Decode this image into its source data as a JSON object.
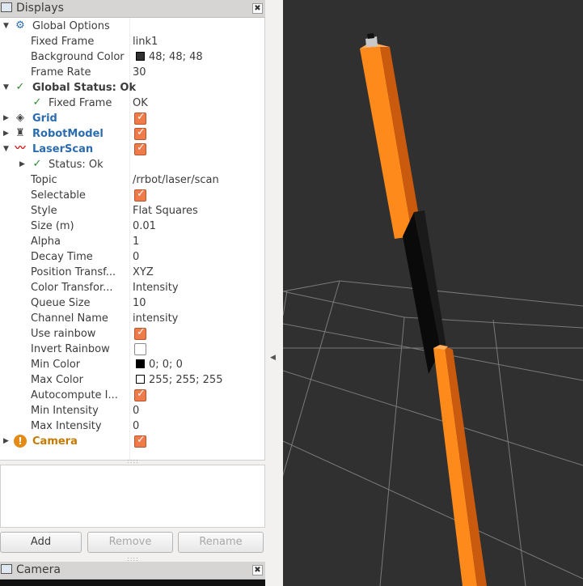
{
  "displays_panel": {
    "title": "Displays",
    "close_glyph": "✖",
    "rows": [
      {
        "name": "Global Options",
        "value": "",
        "kind": "group"
      },
      {
        "name": "Fixed Frame",
        "value": "link1"
      },
      {
        "name": "Background Color",
        "value": "48; 48; 48",
        "swatch": "#303030"
      },
      {
        "name": "Frame Rate",
        "value": "30"
      },
      {
        "name": "Global Status: Ok",
        "value": "",
        "kind": "status"
      },
      {
        "name": "Fixed Frame",
        "value": "OK"
      },
      {
        "name": "Grid",
        "value": ""
      },
      {
        "name": "RobotModel",
        "value": ""
      },
      {
        "name": "LaserScan",
        "value": ""
      },
      {
        "name": "Status: Ok",
        "value": ""
      },
      {
        "name": "Topic",
        "value": "/rrbot/laser/scan"
      },
      {
        "name": "Selectable",
        "value": ""
      },
      {
        "name": "Style",
        "value": "Flat Squares"
      },
      {
        "name": "Size (m)",
        "value": "0.01"
      },
      {
        "name": "Alpha",
        "value": "1"
      },
      {
        "name": "Decay Time",
        "value": "0"
      },
      {
        "name": "Position Transf...",
        "value": "XYZ"
      },
      {
        "name": "Color Transfor...",
        "value": "Intensity"
      },
      {
        "name": "Queue Size",
        "value": "10"
      },
      {
        "name": "Channel Name",
        "value": "intensity"
      },
      {
        "name": "Use rainbow",
        "value": ""
      },
      {
        "name": "Invert Rainbow",
        "value": ""
      },
      {
        "name": "Min Color",
        "value": "0; 0; 0",
        "swatch": "#000000"
      },
      {
        "name": "Max Color",
        "value": "255; 255; 255",
        "swatch": "#ffffff"
      },
      {
        "name": "Autocompute I...",
        "value": ""
      },
      {
        "name": "Min Intensity",
        "value": "0"
      },
      {
        "name": "Max Intensity",
        "value": "0"
      },
      {
        "name": "Camera",
        "value": ""
      }
    ],
    "checkboxes": {
      "grid": true,
      "robotmodel": true,
      "laserscan": true,
      "selectable": true,
      "use_rainbow": true,
      "invert_rainbow": false,
      "autocompute": true,
      "camera": true
    }
  },
  "buttons": {
    "add": "Add",
    "remove": "Remove",
    "rename": "Rename"
  },
  "camera_panel": {
    "title": "Camera",
    "close_glyph": "✖"
  },
  "colors": {
    "background": "#303030",
    "link_orange": "#ff8a1c",
    "link_orange_dark": "#c95a0e",
    "accent_blue": "#2b6cb0",
    "checkbox_orange": "#ef7a4a"
  }
}
